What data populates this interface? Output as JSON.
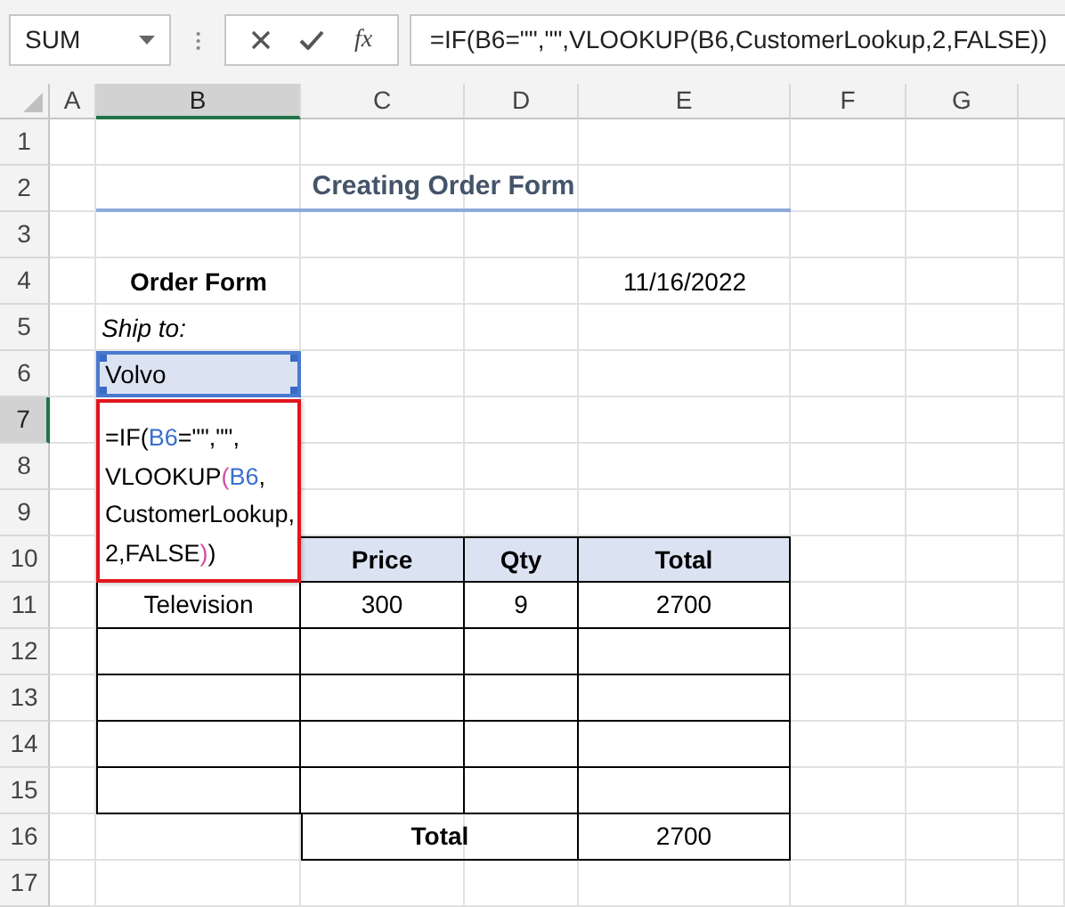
{
  "name_box": {
    "value": "SUM"
  },
  "formula_bar": {
    "function_label": "fx",
    "formula": "=IF(B6=\"\",\"\",VLOOKUP(B6,CustomerLookup,2,FALSE))"
  },
  "columns": [
    {
      "label": "A",
      "selected": false
    },
    {
      "label": "B",
      "selected": true
    },
    {
      "label": "C",
      "selected": false
    },
    {
      "label": "D",
      "selected": false
    },
    {
      "label": "E",
      "selected": false
    },
    {
      "label": "F",
      "selected": false
    },
    {
      "label": "G",
      "selected": false
    }
  ],
  "rows": [
    {
      "label": "1",
      "selected": false
    },
    {
      "label": "2",
      "selected": false
    },
    {
      "label": "3",
      "selected": false
    },
    {
      "label": "4",
      "selected": false
    },
    {
      "label": "5",
      "selected": false
    },
    {
      "label": "6",
      "selected": false
    },
    {
      "label": "7",
      "selected": true
    },
    {
      "label": "8",
      "selected": false
    },
    {
      "label": "9",
      "selected": false
    },
    {
      "label": "10",
      "selected": false
    },
    {
      "label": "11",
      "selected": false
    },
    {
      "label": "12",
      "selected": false
    },
    {
      "label": "13",
      "selected": false
    },
    {
      "label": "14",
      "selected": false
    },
    {
      "label": "15",
      "selected": false
    },
    {
      "label": "16",
      "selected": false
    },
    {
      "label": "17",
      "selected": false
    }
  ],
  "sheet": {
    "title": "Creating Order Form",
    "order_label": "Order Form",
    "date": "11/16/2022",
    "ship_label": "Ship to:",
    "ship_value": "Volvo"
  },
  "editor": {
    "lines": [
      [
        {
          "kind": "plain",
          "text": "=IF("
        },
        {
          "kind": "ref",
          "text": "B6"
        },
        {
          "kind": "plain",
          "text": "=\"\",\"\","
        }
      ],
      [
        {
          "kind": "plain",
          "text": "VLOOKUP"
        },
        {
          "kind": "paren",
          "text": "("
        },
        {
          "kind": "ref",
          "text": "B6"
        },
        {
          "kind": "plain",
          "text": ","
        }
      ],
      [
        {
          "kind": "plain",
          "text": "CustomerLookup,"
        }
      ],
      [
        {
          "kind": "plain",
          "text": "2,FALSE"
        },
        {
          "kind": "paren",
          "text": ")"
        },
        {
          "kind": "plain",
          "text": ")"
        }
      ]
    ]
  },
  "order_table": {
    "header": [
      "Price",
      "Qty",
      "Total"
    ],
    "rows": [
      {
        "kind": "item",
        "cells": [
          "Television",
          "300",
          "9",
          "2700"
        ]
      },
      {
        "kind": "blank"
      },
      {
        "kind": "blank"
      },
      {
        "kind": "blank"
      },
      {
        "kind": "blank"
      },
      {
        "kind": "total",
        "label": "Total",
        "value": "2700"
      }
    ]
  }
}
